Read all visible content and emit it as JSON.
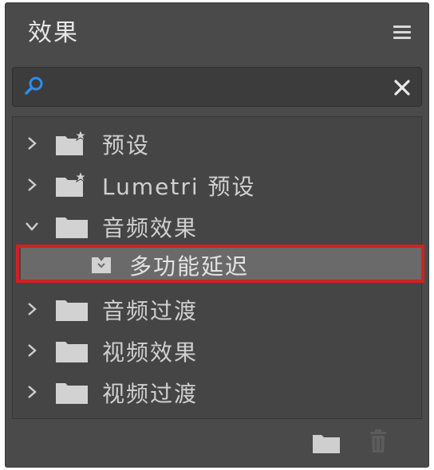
{
  "panel": {
    "title": "效果"
  },
  "search": {
    "value": "",
    "placeholder": ""
  },
  "tree": [
    {
      "label": "预设",
      "expanded": false,
      "icon": "preset-folder-icon"
    },
    {
      "label": "Lumetri 预设",
      "expanded": false,
      "icon": "preset-folder-icon"
    },
    {
      "label": "音频效果",
      "expanded": true,
      "icon": "folder-icon"
    },
    {
      "label": "多功能延迟",
      "expanded": false,
      "icon": "audio-effect-icon",
      "selected": true
    },
    {
      "label": "音频过渡",
      "expanded": false,
      "icon": "folder-icon"
    },
    {
      "label": "视频效果",
      "expanded": false,
      "icon": "folder-icon"
    },
    {
      "label": "视频过渡",
      "expanded": false,
      "icon": "folder-icon"
    }
  ],
  "colors": {
    "panel_bg": "#4a4a4a",
    "highlight": "#d42020"
  }
}
